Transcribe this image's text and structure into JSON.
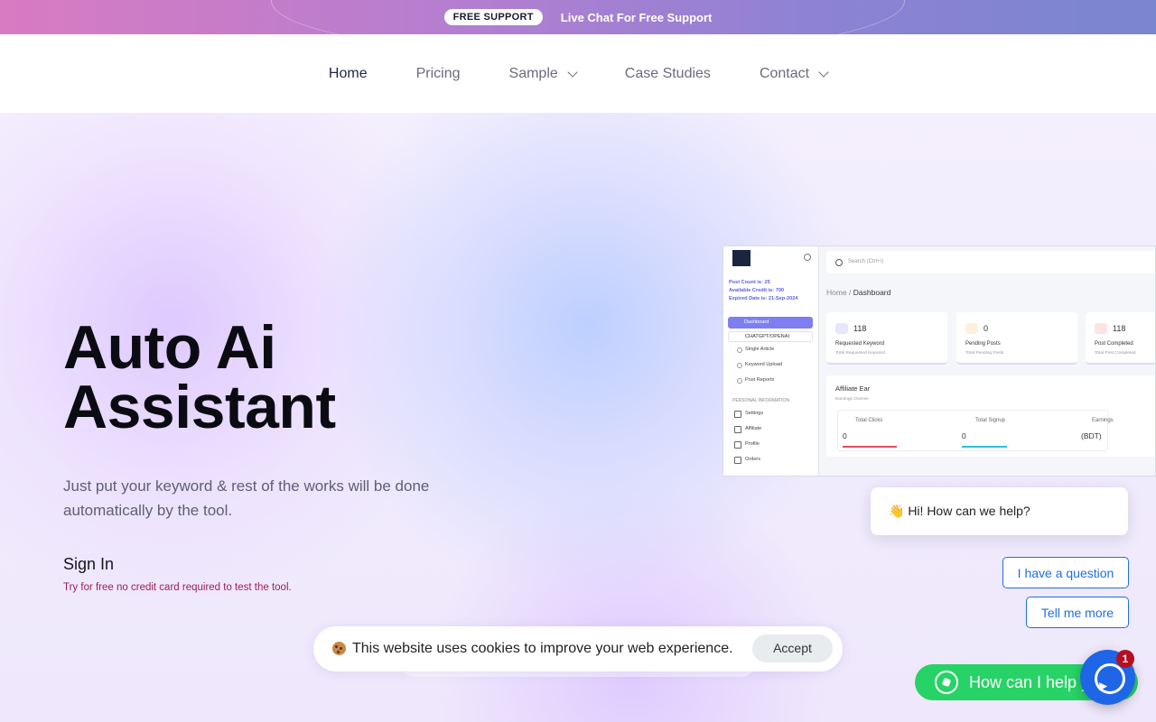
{
  "topbar": {
    "badge": "FREE SUPPORT",
    "text": "Live Chat For Free Support"
  },
  "nav": {
    "items": [
      {
        "label": "Home",
        "active": true
      },
      {
        "label": "Pricing"
      },
      {
        "label": "Sample",
        "dropdown": true
      },
      {
        "label": "Case Studies"
      },
      {
        "label": "Contact",
        "dropdown": true
      }
    ]
  },
  "hero": {
    "title_line1": "Auto Ai",
    "title_line2": "Assistant",
    "subtitle": "Just put your keyword & rest of the works will be done automatically by the tool.",
    "signin": "Sign In",
    "tryfree": "Try for free no credit card required to test the tool."
  },
  "dashboard": {
    "info": [
      "Post Count is: 25",
      "Available Credit is: 700",
      "Expired Date is: 21-Sep-2024"
    ],
    "active_item": "Dashboard",
    "select_item": "CHATGPT/OPENAI",
    "links": [
      "Single Article",
      "Keyword Upload",
      "Post Reports"
    ],
    "section": "PERSONAL INFORMATION",
    "menu": [
      "Settings",
      "Affiliate",
      "Profile",
      "Orders"
    ],
    "search_placeholder": "Search (Ctrl+/)",
    "breadcrumb_home": "Home /",
    "breadcrumb_current": "Dashboard",
    "cards": [
      {
        "num": "118",
        "label": "Requested Keyword",
        "sub": "Total Requested Keyword"
      },
      {
        "num": "0",
        "label": "Pending Posts",
        "sub": "Total Pending Posts"
      },
      {
        "num": "118",
        "label": "Post Completed",
        "sub": "Total Post Completed"
      }
    ],
    "affiliate_title": "Affiliate Ear",
    "affiliate_sub": "Earnings Overvie",
    "metrics": [
      {
        "label": "Total Clicks",
        "value": "0"
      },
      {
        "label": "Total Signup",
        "value": "0"
      },
      {
        "label": "Earnings",
        "value": "(BDT)"
      }
    ],
    "colors": {
      "accent": "#7d7ff0",
      "card1": "#e7e6ff",
      "card2": "#fff0dc",
      "card3": "#ffe2e3"
    }
  },
  "chat": {
    "greeting": "👋 Hi! How can we help?",
    "option1": "I have a question",
    "option2": "Tell me more",
    "whatsapp": "How can I help you?",
    "notification_count": "1"
  },
  "cookie": {
    "text": "This website uses cookies to improve your web experience.",
    "accept": "Accept"
  }
}
